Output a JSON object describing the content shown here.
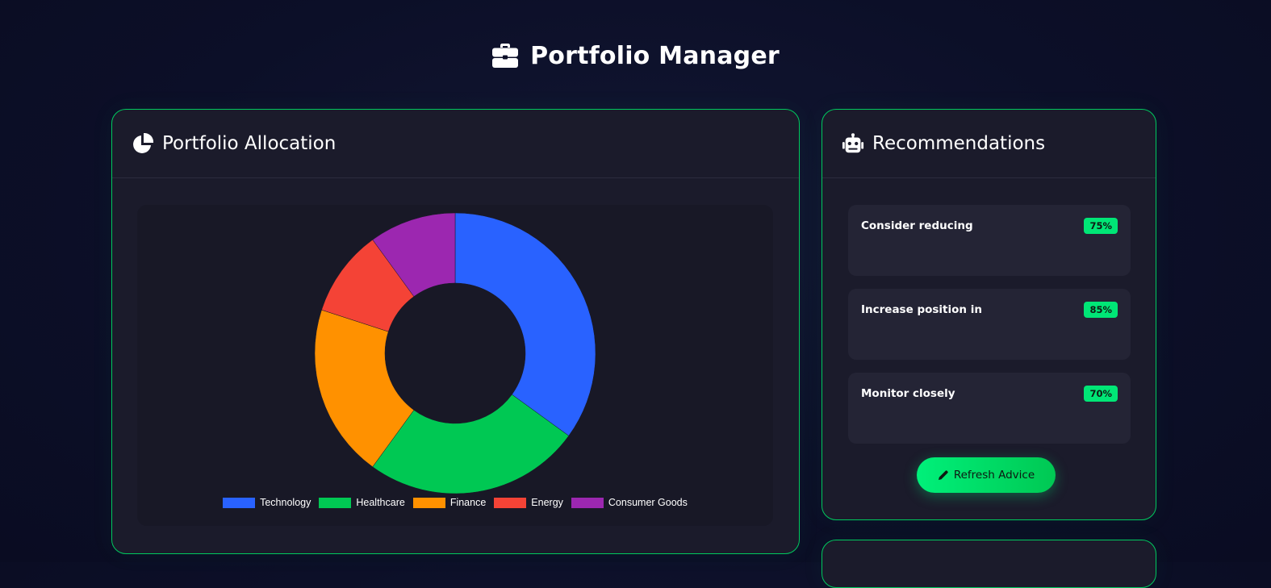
{
  "page": {
    "title": "Portfolio Manager"
  },
  "allocation": {
    "title": "Portfolio Allocation"
  },
  "recommendations": {
    "title": "Recommendations",
    "items": [
      {
        "title": "Consider reducing",
        "confidence": "75%"
      },
      {
        "title": "Increase position in",
        "confidence": "85%"
      },
      {
        "title": "Monitor closely",
        "confidence": "70%"
      }
    ],
    "refresh_label": "Refresh Advice"
  },
  "colors": {
    "accent": "#00e676",
    "card_bg": "#1b1b2b",
    "page_bg": "#0c0f28"
  },
  "chart_data": {
    "type": "pie",
    "donut": true,
    "title": "",
    "categories": [
      "Technology",
      "Healthcare",
      "Finance",
      "Energy",
      "Consumer Goods"
    ],
    "values": [
      35,
      25,
      20,
      10,
      10
    ],
    "colors": [
      "#2962ff",
      "#00c853",
      "#ff9100",
      "#f44336",
      "#9c27b0"
    ],
    "legend": "bottom"
  }
}
